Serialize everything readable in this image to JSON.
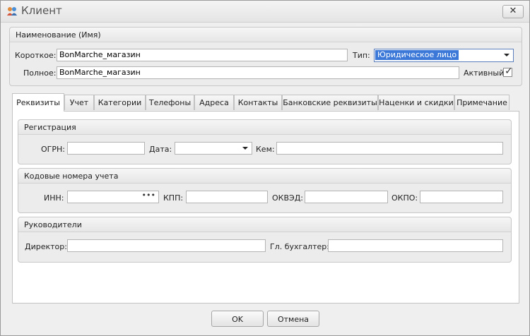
{
  "window": {
    "title": "Клиент",
    "close_label": "✕"
  },
  "name_group": {
    "title": "Наименование (Имя)",
    "short_label": "Короткое:",
    "short_value": "BonMarche_магазин",
    "type_label": "Тип:",
    "type_value": "Юридическое лицо",
    "full_label": "Полное:",
    "full_value": "BonMarche_магазин",
    "active_label": "Активный",
    "active_checked": true
  },
  "tabs": [
    {
      "label": "Реквизиты",
      "active": true
    },
    {
      "label": "Учет"
    },
    {
      "label": "Категории"
    },
    {
      "label": "Телефоны"
    },
    {
      "label": "Адреса"
    },
    {
      "label": "Контакты"
    },
    {
      "label": "Банковские реквизиты"
    },
    {
      "label": "Наценки и скидки"
    },
    {
      "label": "Примечание"
    }
  ],
  "registration": {
    "title": "Регистрация",
    "ogrn_label": "ОГРН:",
    "ogrn_value": "",
    "date_label": "Дата:",
    "date_value": "",
    "issued_by_label": "Кем:",
    "issued_by_value": ""
  },
  "codes": {
    "title": "Кодовые номера учета",
    "inn_label": "ИНН:",
    "inn_value": "",
    "inn_button": "•••",
    "kpp_label": "КПП:",
    "kpp_value": "",
    "okved_label": "ОКВЭД:",
    "okved_value": "",
    "okpo_label": "ОКПО:",
    "okpo_value": ""
  },
  "managers": {
    "title": "Руководители",
    "director_label": "Директор:",
    "director_value": "",
    "accountant_label": "Гл. бухгалтер:",
    "accountant_value": ""
  },
  "buttons": {
    "ok": "OK",
    "cancel": "Отмена"
  },
  "colors": {
    "selection": "#3b78d8",
    "window_bg": "#efefef"
  },
  "icons": {
    "app": "people-icon",
    "close": "close-icon",
    "checkbox": "checkmark-icon"
  }
}
